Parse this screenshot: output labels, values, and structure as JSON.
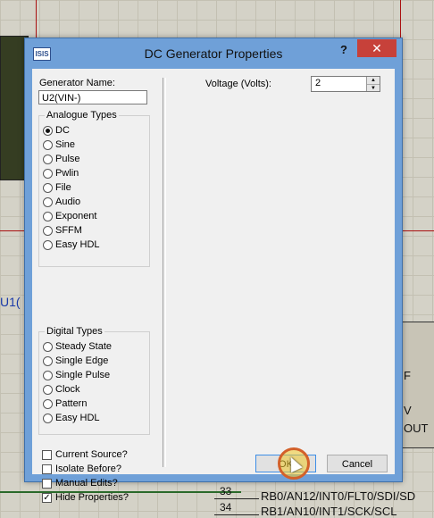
{
  "window": {
    "title": "DC Generator Properties",
    "help": "?",
    "close": "✕",
    "icon": "ISIS"
  },
  "generator_name": {
    "label": "Generator Name:",
    "value": "U2(VIN-)"
  },
  "analogue": {
    "title": "Analogue Types",
    "selected": "DC",
    "options": [
      "DC",
      "Sine",
      "Pulse",
      "Pwlin",
      "File",
      "Audio",
      "Exponent",
      "SFFM",
      "Easy HDL"
    ]
  },
  "digital": {
    "title": "Digital Types",
    "options": [
      "Steady State",
      "Single Edge",
      "Single Pulse",
      "Clock",
      "Pattern",
      "Easy HDL"
    ]
  },
  "checkboxes": [
    {
      "label": "Current Source?",
      "checked": false
    },
    {
      "label": "Isolate Before?",
      "checked": false
    },
    {
      "label": "Manual Edits?",
      "checked": false
    },
    {
      "label": "Hide Properties?",
      "checked": true
    }
  ],
  "voltage": {
    "label": "Voltage (Volts):",
    "value": "2"
  },
  "buttons": {
    "ok": "OK",
    "cancel": "Cancel"
  },
  "schematic": {
    "u1_label": "U1(",
    "pins": [
      "33",
      "34"
    ],
    "pin_labels": [
      "RB0/AN12/INT0/FLT0/SDI/SD",
      "RB1/AN10/INT1/SCK/SCL"
    ],
    "chip_labels": [
      "F",
      "V",
      "OUT"
    ]
  }
}
